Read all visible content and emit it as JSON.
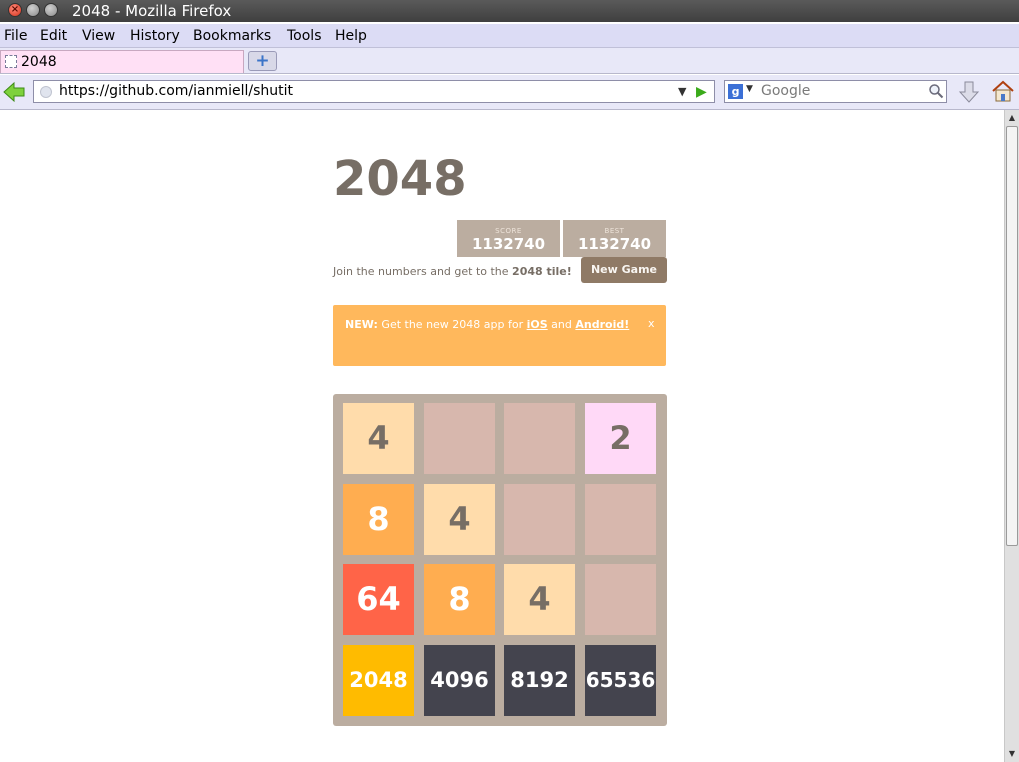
{
  "window": {
    "title": "2048 - Mozilla Firefox",
    "close_glyph": "×"
  },
  "menu": {
    "items": [
      "File",
      "Edit",
      "View",
      "History",
      "Bookmarks",
      "Tools",
      "Help"
    ]
  },
  "tabs": [
    {
      "label": "2048"
    }
  ],
  "new_tab_glyph": "+",
  "navbar": {
    "url": "https://github.com/ianmiell/shutit",
    "search_placeholder": "Google",
    "search_engine_glyph": "g",
    "dropdown_glyph": "▼",
    "go_glyph": "▶"
  },
  "scrollbar": {
    "up_glyph": "▲",
    "down_glyph": "▼"
  },
  "game": {
    "title": "2048",
    "score_label": "SCORE",
    "score": "1132740",
    "best_label": "BEST",
    "best": "1132740",
    "intro_prefix": "Join the numbers and get to the ",
    "intro_bold": "2048 tile!",
    "new_game_label": "New Game",
    "banner": {
      "new_label": "NEW:",
      "text_prefix": " Get the new 2048 app for ",
      "ios_link": "iOS",
      "and": " and ",
      "android_link": "Android!",
      "close": "x"
    },
    "grid": [
      [
        "4",
        "",
        "",
        "2"
      ],
      [
        "8",
        "4",
        "",
        ""
      ],
      [
        "64",
        "8",
        "4",
        ""
      ],
      [
        "2048",
        "4096",
        "8192",
        "65536"
      ]
    ],
    "tile_colors": {
      "empty": "#d7b7ad",
      "2": "#ffd9f7",
      "4": "#ffdcab",
      "8": "#ffad50",
      "64": "#ff6448",
      "2048": "#ffbb00",
      "4096": "#44444e",
      "8192": "#44444e",
      "65536": "#44444e"
    },
    "tile_text_colors": {
      "2": "#776e65",
      "4": "#776e65",
      "default": "#ffffff"
    }
  }
}
